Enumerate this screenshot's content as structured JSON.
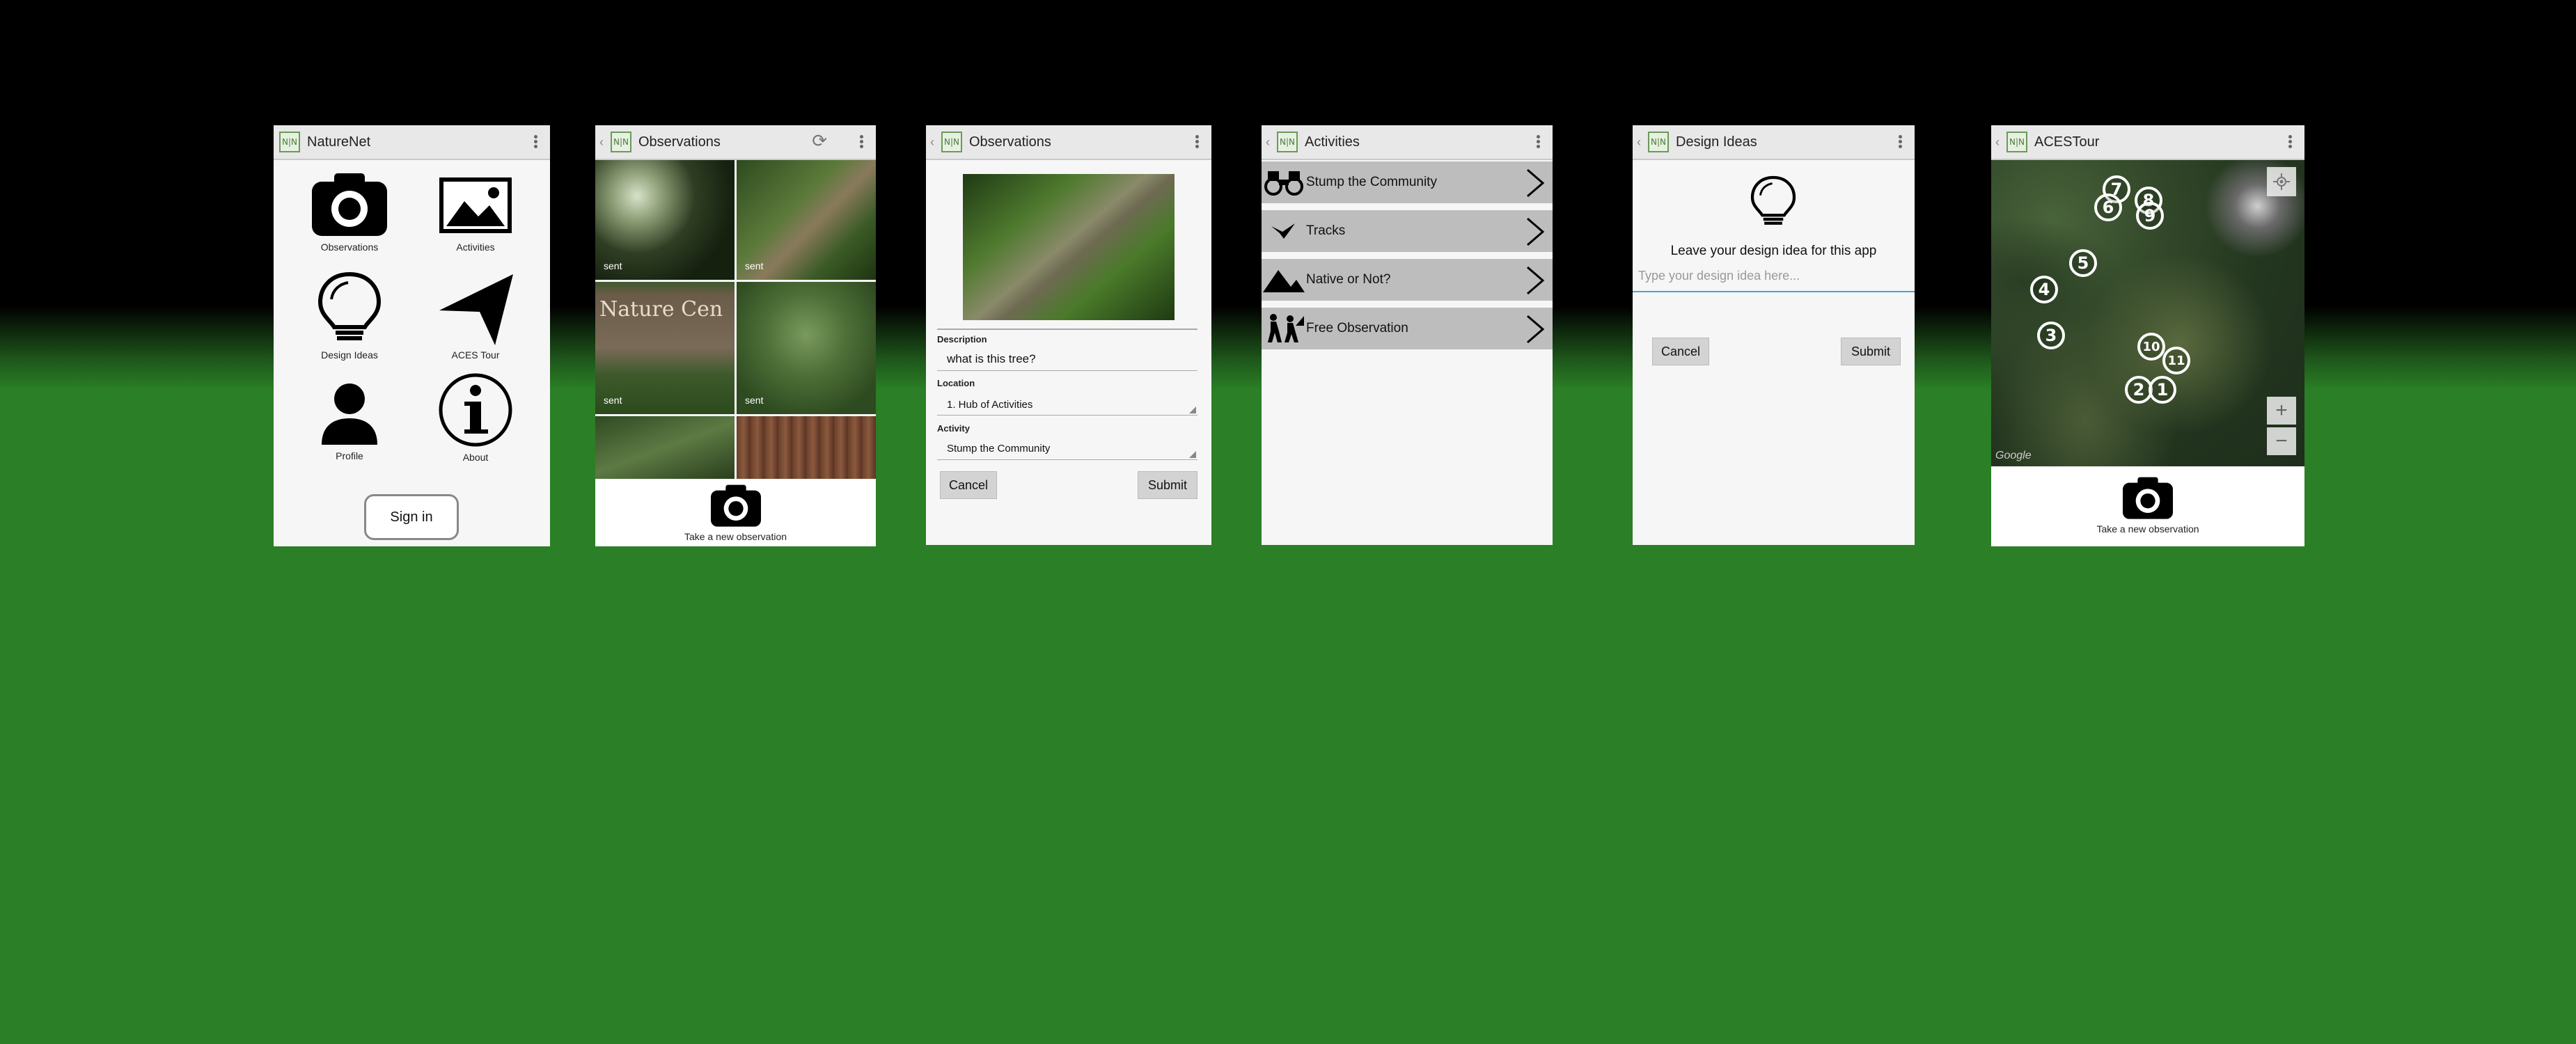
{
  "screens": {
    "home": {
      "title": "NatureNet",
      "tiles": [
        "Observations",
        "Activities",
        "Design Ideas",
        "ACES Tour",
        "Profile",
        "About"
      ],
      "signin_label": "Sign in"
    },
    "observations_grid": {
      "title": "Observations",
      "sent_label": "sent",
      "sign_text": "Nature Cen",
      "camera_caption": "Take a new observation"
    },
    "observation_form": {
      "title": "Observations",
      "description_label": "Description",
      "description_value": "what is this tree?",
      "location_label": "Location",
      "location_value": "1. Hub of Activities",
      "activity_label": "Activity",
      "activity_value": "Stump the Community",
      "cancel_label": "Cancel",
      "submit_label": "Submit"
    },
    "activities": {
      "title": "Activities",
      "items": [
        {
          "label": "Stump the Community",
          "icon": "binoculars-icon"
        },
        {
          "label": "Tracks",
          "icon": "bird-icon"
        },
        {
          "label": "Native or Not?",
          "icon": "mountain-icon"
        },
        {
          "label": "Free Observation",
          "icon": "hikers-icon"
        }
      ]
    },
    "design_ideas": {
      "title": "Design Ideas",
      "prompt": "Leave your design idea for this app",
      "input_placeholder": "Type your design idea here...",
      "cancel_label": "Cancel",
      "submit_label": "Submit"
    },
    "aces_tour": {
      "title": "ACESTour",
      "markers": [
        "1",
        "2",
        "3",
        "4",
        "5",
        "6",
        "7",
        "8",
        "9",
        "10",
        "11"
      ],
      "zoom_in": "+",
      "zoom_out": "−",
      "map_attribution": "Google",
      "camera_caption": "Take a new observation"
    }
  },
  "logo_text": "N|N",
  "colors": {
    "background_green": "#2b7f26",
    "action_bar": "#e8e8e8",
    "activity_row": "#bdbdbd",
    "input_focus": "#4aa3d8"
  }
}
